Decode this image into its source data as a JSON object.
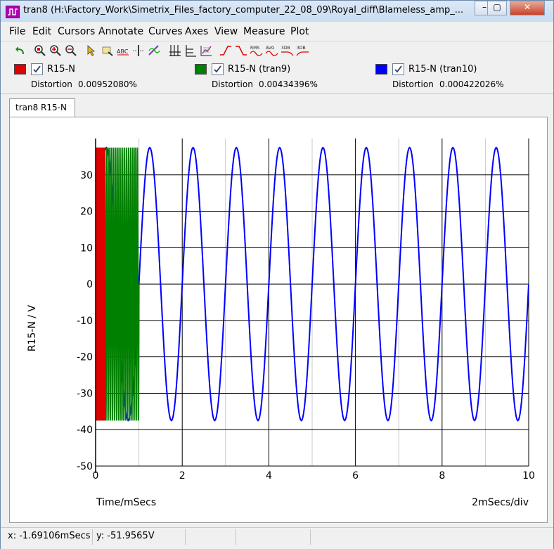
{
  "window": {
    "title": "tran8 (H:\\Factory_Work\\Simetrix_Files_factory_computer_22_08_09\\Royal_diff\\Blameless_amp_...",
    "minimize_label": "–",
    "maximize_label": "▢",
    "close_label": "✕"
  },
  "menu": [
    "File",
    "Edit",
    "Cursors",
    "Annotate",
    "Curves",
    "Axes",
    "View",
    "Measure",
    "Plot"
  ],
  "toolbar_icons": [
    "undo-icon",
    "zoom-box-icon",
    "zoom-in-icon",
    "zoom-out-icon",
    "cursor-icon",
    "annotate-icon",
    "label-icon",
    "cursor-align-icon",
    "measure-icon",
    "grid-icon",
    "axes-icon",
    "plot-edit-icon",
    "rise-icon",
    "fall-icon",
    "rms-icon",
    "avg-icon",
    "3db-high-icon",
    "3db-low-icon"
  ],
  "toolbar_text": {
    "rms": "RMS",
    "avg": "AVG",
    "db1": "3DB",
    "db2": "3DB"
  },
  "legend": [
    {
      "name": "R15-N",
      "color": "#e00000",
      "checked": true,
      "measure_label": "Distortion",
      "measure_value": "0.00952080%"
    },
    {
      "name": "R15-N (tran9)",
      "color": "#008000",
      "checked": true,
      "measure_label": "Distortion",
      "measure_value": "0.00434396%"
    },
    {
      "name": "R15-N (tran10)",
      "color": "#0000ff",
      "checked": true,
      "measure_label": "Distortion",
      "measure_value": "0.000422026%"
    }
  ],
  "tab": {
    "label": "tran8 R15-N"
  },
  "status": {
    "x": "x: -1.69106mSecs",
    "y": "y: -51.9565V"
  },
  "chart_data": {
    "type": "line",
    "ylabel": "R15-N / V",
    "xlabel": "Time/mSecs",
    "x_scale_note": "2mSecs/div",
    "xlim": [
      0,
      10
    ],
    "ylim": [
      -50,
      40
    ],
    "x_ticks": [
      0,
      2,
      4,
      6,
      8,
      10
    ],
    "y_ticks": [
      -50,
      -40,
      -30,
      -20,
      -10,
      0,
      10,
      20,
      30
    ],
    "x_tick_labels": [
      "0",
      "2",
      "4",
      "6",
      "8",
      "10"
    ],
    "y_tick_labels": [
      "-50",
      "-40",
      "-30",
      "-20",
      "-10",
      "0",
      "10",
      "20",
      "30"
    ],
    "grid": true,
    "series": [
      {
        "name": "R15-N",
        "color": "#e00000",
        "waveform": "sine",
        "amplitude": 37.5,
        "frequency_khz": 50,
        "x_range": [
          0,
          0.22
        ]
      },
      {
        "name": "R15-N (tran9)",
        "color": "#008000",
        "waveform": "sine",
        "amplitude": 37.5,
        "frequency_khz": 20,
        "x_range": [
          0,
          1.0
        ]
      },
      {
        "name": "R15-N (tran10)",
        "color": "#0000ff",
        "waveform": "sine",
        "amplitude": 37.5,
        "frequency_khz": 1,
        "x_range": [
          0,
          10
        ]
      }
    ]
  }
}
